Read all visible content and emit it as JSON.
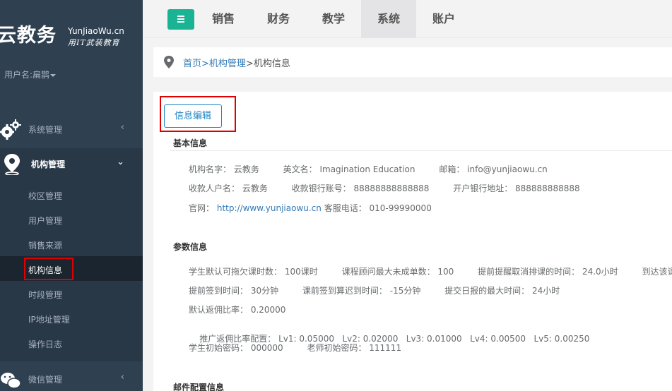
{
  "brand": {
    "name_cn": "云教务",
    "name_en": "YunJiaoWu.cn",
    "slogan": "用IT武装教育"
  },
  "user": {
    "label": "用户名:扁鹊"
  },
  "sidebar": {
    "groups": [
      {
        "label": "系统管理",
        "icon": "gears-icon",
        "arrow": "‹"
      },
      {
        "label": "机构管理",
        "icon": "location-pin-icon",
        "arrow": "⌄"
      },
      {
        "label": "微信管理",
        "icon": "wechat-icon",
        "arrow": "‹"
      }
    ],
    "sub_items": [
      "校区管理",
      "用户管理",
      "销售来源",
      "机构信息",
      "时段管理",
      "IP地址管理",
      "操作日志"
    ]
  },
  "topbar": {
    "tabs": [
      "销售",
      "财务",
      "教学",
      "系统",
      "账户"
    ],
    "active_tab": "系统"
  },
  "breadcrumb": {
    "home": "首页",
    "parent": ">机构管理",
    "current": ">机构信息"
  },
  "main": {
    "edit_button": "信息编辑",
    "basic": {
      "title": "基本信息",
      "org_name": "机构名字： 云教务",
      "en_name": "英文名： Imagination Education",
      "email": "邮箱： info@yunjiaowu.cn",
      "payee": "收款人户名： 云教务",
      "account": "收款银行账号： 88888888888888",
      "bank": "开户银行地址： 888888888888",
      "site_label": "官网：",
      "site_url": "http://www.yunjiaowu.cn",
      "phone": "客服电话： 010-99990000"
    },
    "params": {
      "title": "参数信息",
      "r1": [
        "学生默认可拖欠课时数： 100课时",
        "课程顾问最大未成单数： 100",
        "提前提醒取消排课的时间： 24.0小时",
        "到达该课时"
      ],
      "r2": [
        "提前签到时间： 30分钟",
        "课前签到算迟到时间： -15分钟",
        "提交日报的最大时间： 24小时"
      ],
      "r3": "默认返佣比率： 0.20000",
      "r4": "推广返佣比率配置： Lv1: 0.05000   Lv2: 0.02000   Lv3: 0.01000   Lv4: 0.00500   Lv5: 0.00250",
      "r5": [
        "学生初始密码： 000000",
        "老师初始密码： 111111"
      ]
    },
    "mail": {
      "title": "邮件配置信息"
    }
  },
  "colors": {
    "sidebar": "#2f4050",
    "accent": "#1ab394",
    "link": "#337ab7",
    "highlight": "#e00000"
  }
}
